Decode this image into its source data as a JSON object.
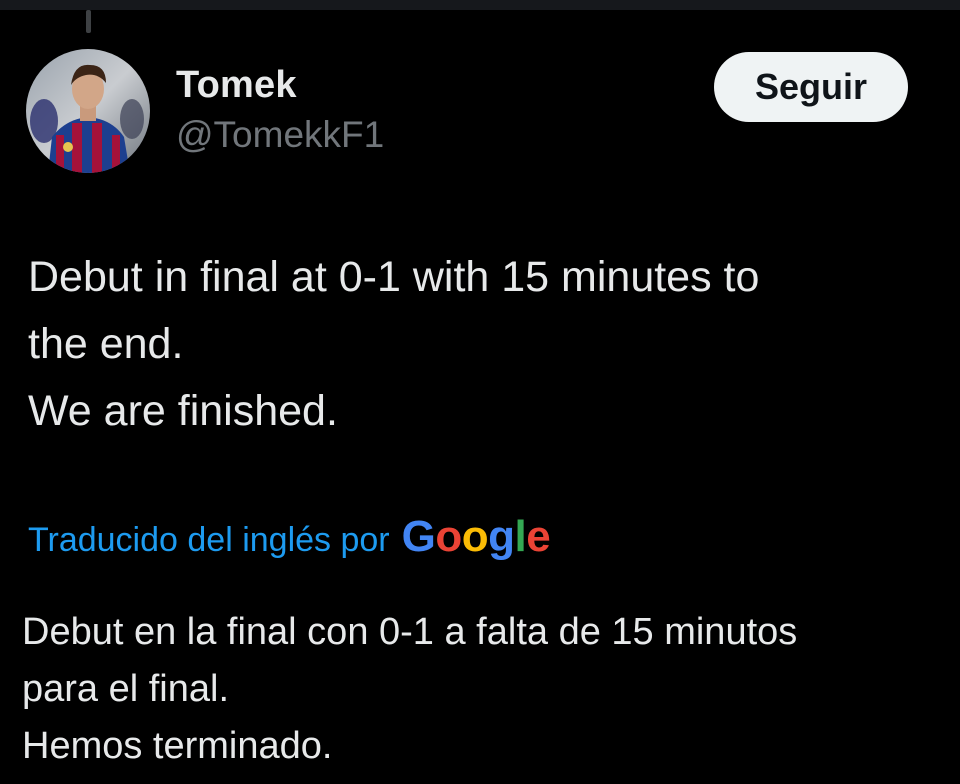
{
  "author": {
    "display_name": "Tomek",
    "handle": "@TomekkF1"
  },
  "follow_button": {
    "label": "Seguir"
  },
  "tweet": {
    "lines": [
      "Debut in final at 0-1 with 15 minutes to",
      "the end.",
      "We are finished."
    ]
  },
  "translation": {
    "attribution": "Traducido del inglés por",
    "provider_letters": [
      {
        "char": "G",
        "color": "#4285f4"
      },
      {
        "char": "o",
        "color": "#ea4335"
      },
      {
        "char": "o",
        "color": "#fbbc05"
      },
      {
        "char": "g",
        "color": "#4285f4"
      },
      {
        "char": "l",
        "color": "#34a853"
      },
      {
        "char": "e",
        "color": "#ea4335"
      }
    ],
    "lines": [
      "Debut en la final con 0-1 a falta de 15 minutos",
      "para el final.",
      "Hemos terminado."
    ]
  },
  "colors": {
    "background": "#000000",
    "text_primary": "#e7e9ea",
    "text_secondary": "#71767b",
    "link": "#1d9bf0",
    "button_bg": "#eff3f4"
  }
}
